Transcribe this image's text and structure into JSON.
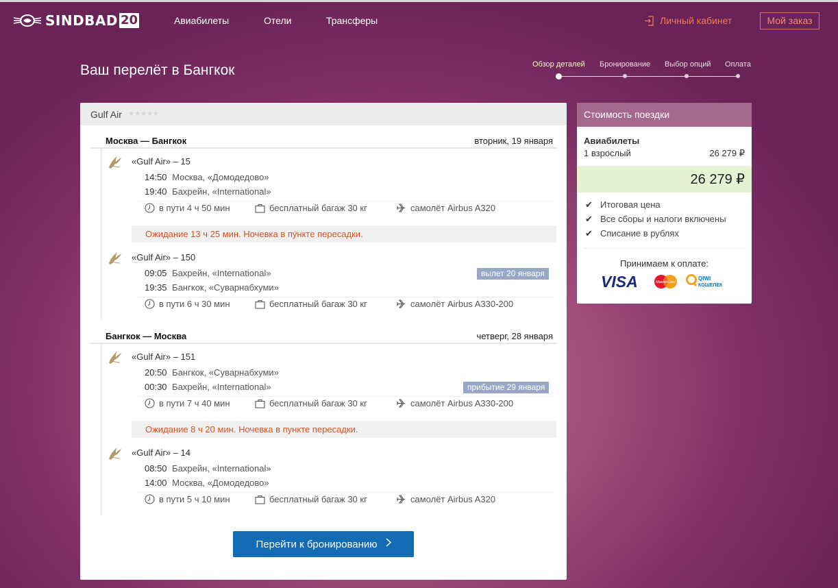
{
  "header": {
    "logo_text": "SINDBAD",
    "logo_badge": "20",
    "nav": [
      "Авиабилеты",
      "Отели",
      "Трансферы"
    ],
    "login_label": "Личный кабинет",
    "order_label": "Мой заказ"
  },
  "title": "Ваш перелёт в Бангкок",
  "steps": [
    {
      "label": "Обзор деталей",
      "active": true
    },
    {
      "label": "Бронирование",
      "active": false
    },
    {
      "label": "Выбор опций",
      "active": false
    },
    {
      "label": "Оплата",
      "active": false
    }
  ],
  "trip": {
    "airline": "Gulf Air",
    "stars": "★★★★★",
    "routes": [
      {
        "name": "Москва — Бангкок",
        "date": "вторник, 19 января",
        "segments": [
          {
            "flight": "«Gulf Air» – 15",
            "dep_time": "14:50",
            "dep_place": "Москва, «Домодедово»",
            "arr_time": "19:40",
            "arr_place": "Бахрейн, «International»",
            "duration": "в пути 4 ч 50 мин",
            "baggage": "бесплатный багаж 30 кг",
            "aircraft": "самолёт Airbus A320"
          },
          {
            "flight": "«Gulf Air» – 150",
            "dep_time": "09:05",
            "dep_place": "Бахрейн, «International»",
            "arr_time": "19:35",
            "arr_place": "Бангкок, «Суварнабхуми»",
            "duration": "в пути 6 ч 30 мин",
            "baggage": "бесплатный багаж 30 кг",
            "aircraft": "самолёт Airbus A330-200",
            "badge": "вылет 20 января"
          }
        ],
        "layover": "Ожидание 13 ч 25 мин. Ночевка в пункте пересадки."
      },
      {
        "name": "Бангкок — Москва",
        "date": "четверг, 28 января",
        "segments": [
          {
            "flight": "«Gulf Air» – 151",
            "dep_time": "20:50",
            "dep_place": "Бангкок, «Суварнабхуми»",
            "arr_time": "00:30",
            "arr_place": "Бахрейн, «International»",
            "duration": "в пути 7 ч 40 мин",
            "baggage": "бесплатный багаж 30 кг",
            "aircraft": "самолёт Airbus A330-200",
            "badge": "прибытие 29 января"
          },
          {
            "flight": "«Gulf Air» – 14",
            "dep_time": "08:50",
            "dep_place": "Бахрейн, «International»",
            "arr_time": "14:00",
            "arr_place": "Москва, «Домодедово»",
            "duration": "в пути 5 ч 10 мин",
            "baggage": "бесплатный багаж 30 кг",
            "aircraft": "самолёт Airbus A320"
          }
        ],
        "layover": "Ожидание 8 ч 20 мин. Ночевка в пункте пересадки."
      }
    ],
    "book_button": "Перейти к бронированию"
  },
  "price": {
    "title": "Стоимость поездки",
    "section": "Авиабилеты",
    "passengers": "1 взрослый",
    "amount": "26 279 ₽",
    "total": "26 279 ₽",
    "features": [
      "Итоговая цена",
      "Все сборы и налоги включены",
      "Списание в рублях"
    ],
    "pay_label": "Принимаем к оплате:",
    "pay_methods": {
      "visa": "VISA",
      "mastercard": "MasterCard",
      "qiwi_1": "QIWI",
      "qiwi_2": "КОШЕЛЕК"
    }
  },
  "colors": {
    "accent_orange": "#f17b58",
    "button_blue": "#126bb3",
    "price_header": "#a5688f",
    "total_bg": "#e5f2d4",
    "layover_text": "#d9521f",
    "badge_bg": "#98a7c6"
  }
}
